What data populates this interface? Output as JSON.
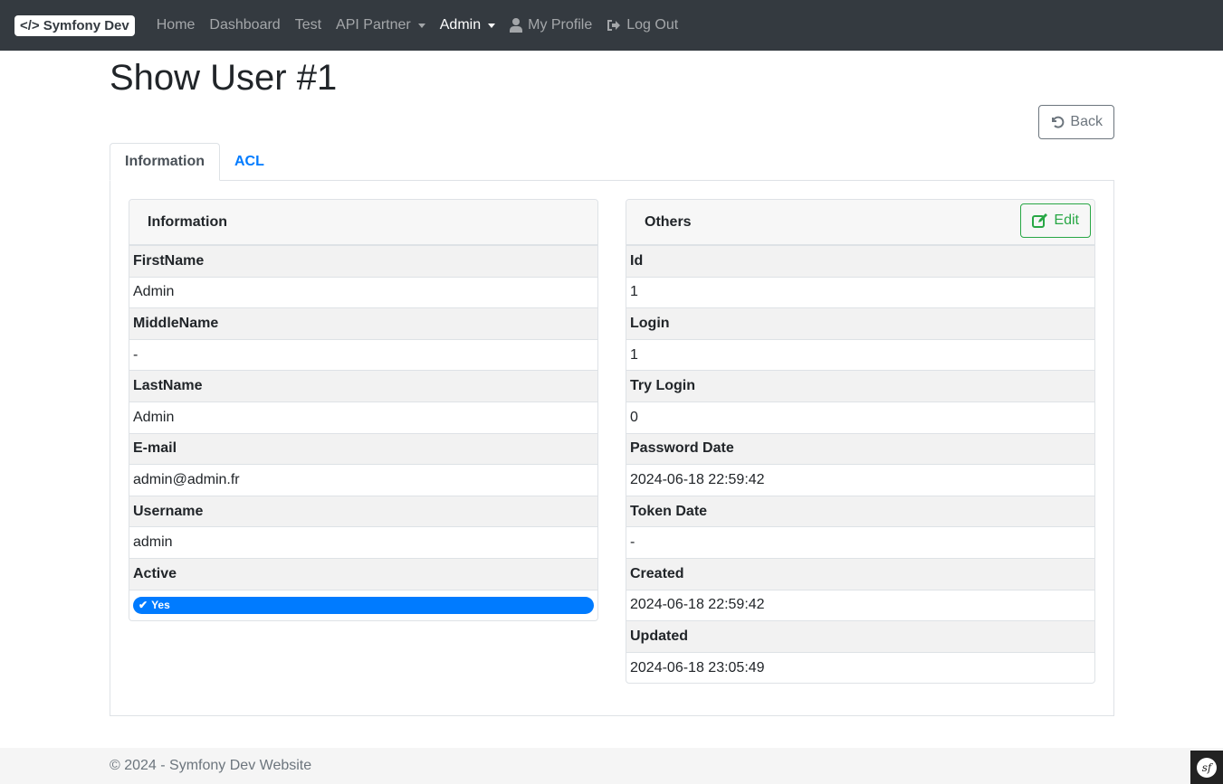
{
  "navbar": {
    "brand": "Symfony Dev",
    "items": [
      {
        "label": "Home"
      },
      {
        "label": "Dashboard"
      },
      {
        "label": "Test"
      },
      {
        "label": "API Partner"
      },
      {
        "label": "Admin"
      },
      {
        "label": "My Profile"
      },
      {
        "label": "Log Out"
      }
    ]
  },
  "page": {
    "title": "Show User #1",
    "back_label": "Back"
  },
  "tabs": [
    {
      "label": "Information"
    },
    {
      "label": "ACL"
    }
  ],
  "info_card": {
    "title": "Information",
    "fields": [
      {
        "label": "FirstName",
        "value": "Admin"
      },
      {
        "label": "MiddleName",
        "value": "-"
      },
      {
        "label": "LastName",
        "value": "Admin"
      },
      {
        "label": "E-mail",
        "value": "admin@admin.fr"
      },
      {
        "label": "Username",
        "value": "admin"
      }
    ],
    "active_label": "Active",
    "active_value": "Yes"
  },
  "others_card": {
    "title": "Others",
    "edit_label": "Edit",
    "fields": [
      {
        "label": "Id",
        "value": "1"
      },
      {
        "label": "Login",
        "value": "1"
      },
      {
        "label": "Try Login",
        "value": "0"
      },
      {
        "label": "Password Date",
        "value": "2024-06-18 22:59:42"
      },
      {
        "label": "Token Date",
        "value": "-"
      },
      {
        "label": "Created",
        "value": "2024-06-18 22:59:42"
      },
      {
        "label": "Updated",
        "value": "2024-06-18 23:05:49"
      }
    ]
  },
  "footer": {
    "text": "© 2024 - Symfony Dev Website"
  }
}
